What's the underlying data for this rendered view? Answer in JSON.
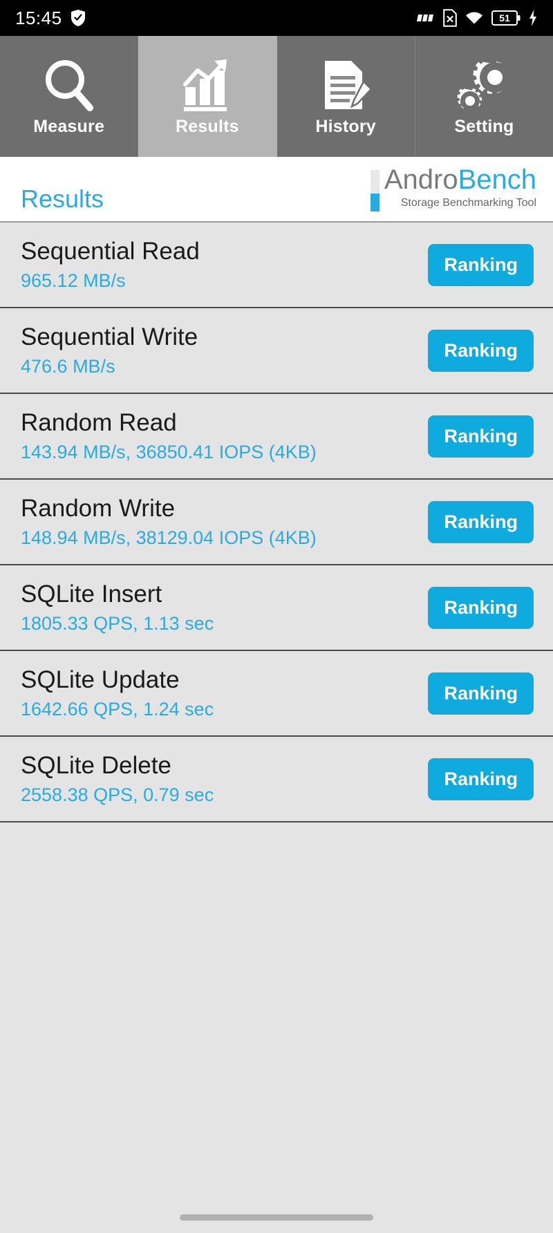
{
  "statusbar": {
    "time": "15:45",
    "icons": [
      "shield-check-icon",
      "signal-bars-icon",
      "sim-card-off-icon",
      "wifi-icon",
      "battery-icon",
      "charging-bolt-icon"
    ],
    "battery_level": "51"
  },
  "tabs": [
    {
      "label": "Measure",
      "icon": "magnifier-icon",
      "active": false
    },
    {
      "label": "Results",
      "icon": "bar-chart-icon",
      "active": true
    },
    {
      "label": "History",
      "icon": "document-pencil-icon",
      "active": false
    },
    {
      "label": "Setting",
      "icon": "gears-icon",
      "active": false
    }
  ],
  "header": {
    "page_title": "Results",
    "brand_first": "Andro",
    "brand_second": "Bench",
    "brand_tagline": "Storage Benchmarking Tool"
  },
  "results": [
    {
      "title": "Sequential Read",
      "value": "965.12 MB/s",
      "button": "Ranking"
    },
    {
      "title": "Sequential Write",
      "value": "476.6 MB/s",
      "button": "Ranking"
    },
    {
      "title": "Random Read",
      "value": "143.94 MB/s, 36850.41 IOPS (4KB)",
      "button": "Ranking"
    },
    {
      "title": "Random Write",
      "value": "148.94 MB/s, 38129.04 IOPS (4KB)",
      "button": "Ranking"
    },
    {
      "title": "SQLite Insert",
      "value": "1805.33 QPS, 1.13 sec",
      "button": "Ranking"
    },
    {
      "title": "SQLite Update",
      "value": "1642.66 QPS, 1.24 sec",
      "button": "Ranking"
    },
    {
      "title": "SQLite Delete",
      "value": "2558.38 QPS, 0.79 sec",
      "button": "Ranking"
    }
  ],
  "colors": {
    "accent_blue": "#29abe2",
    "button_blue": "#0faade",
    "tab_inactive": "#6e6e6e",
    "tab_active": "#b4b4b4",
    "row_bg": "#e4e4e4",
    "statusbar_bg": "#000000"
  }
}
